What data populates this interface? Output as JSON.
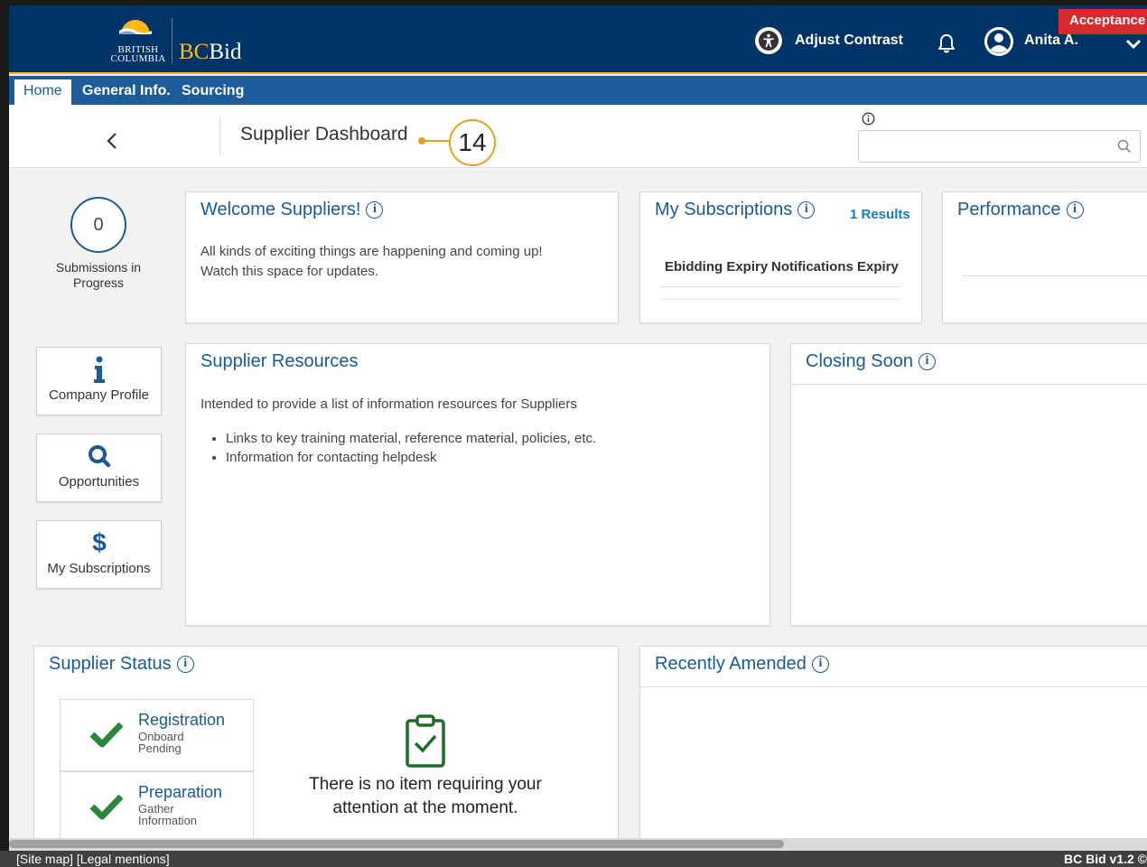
{
  "header": {
    "logo_line1": "BRITISH",
    "logo_line2": "COLUMBIA",
    "app_name_bc": "BC",
    "app_name_bid": "Bid",
    "adjust_contrast": "Adjust Contrast",
    "user_name": "Anita A.",
    "environment_badge": "Acceptance"
  },
  "nav": {
    "tabs": [
      {
        "label": "Home",
        "active": true
      },
      {
        "label": "General Info."
      },
      {
        "label": "Sourcing"
      }
    ]
  },
  "subheader": {
    "page_title": "Supplier Dashboard",
    "callout_number": "14",
    "search_placeholder": ""
  },
  "sidebar": {
    "submissions_count": "0",
    "submissions_label": "Submissions in Progress",
    "tiles": [
      {
        "label": "Company Profile",
        "icon": "info-icon"
      },
      {
        "label": "Opportunities",
        "icon": "search-icon"
      },
      {
        "label": "My Subscriptions",
        "icon": "dollar-icon"
      }
    ]
  },
  "welcome": {
    "title": "Welcome Suppliers!",
    "line1": "All kinds of exciting things are happening and coming up!",
    "line2": "Watch this space for updates."
  },
  "subscriptions": {
    "title": "My Subscriptions",
    "results": "1 Results",
    "col1": "Ebidding Expiry",
    "col2": "Notifications Expiry"
  },
  "performance": {
    "title": "Performance"
  },
  "resources": {
    "title": "Supplier Resources",
    "intro": "Intended to provide a list of information resources for Suppliers",
    "bullets": [
      "Links to key training material, reference material, policies, etc.",
      "Information for contacting helpdesk"
    ]
  },
  "closing_soon": {
    "title": "Closing Soon"
  },
  "supplier_status": {
    "title": "Supplier Status",
    "steps": [
      {
        "title": "Registration",
        "sub1": "Onboard",
        "sub2": "Pending"
      },
      {
        "title": "Preparation",
        "sub1": "Gather",
        "sub2": "Information"
      }
    ],
    "empty_line1": "There is no item requiring your",
    "empty_line2": "attention at the moment."
  },
  "recently_amended": {
    "title": "Recently Amended"
  },
  "footer": {
    "links": "[Site map] [Legal mentions]",
    "version": "BC Bid v1.2 ©"
  },
  "colors": {
    "header_bg": "#003366",
    "gold": "#fcba19",
    "nav_bg": "#1c5c9a",
    "link_blue": "#1a5a96",
    "badge_red": "#d8292f",
    "check_green": "#2e8540"
  }
}
